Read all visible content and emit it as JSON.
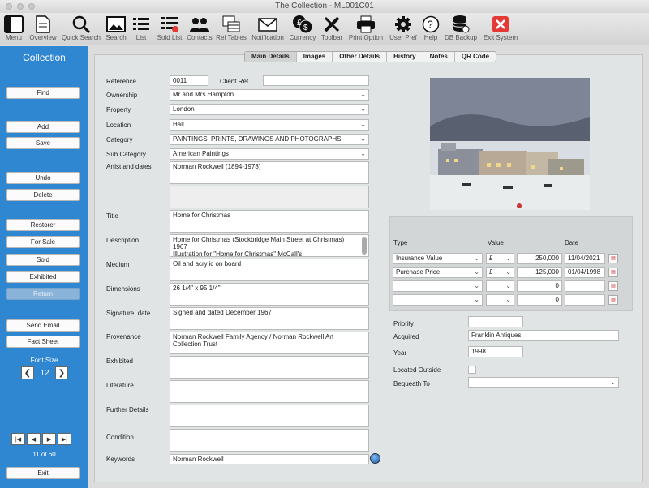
{
  "window": {
    "title": "The Collection - ML001C01"
  },
  "toolbar": [
    {
      "label": "Menu",
      "icon": "menu-icon"
    },
    {
      "label": "Overview",
      "icon": "overview-icon"
    },
    {
      "label": "Quick Search",
      "icon": "magnifier-icon"
    },
    {
      "label": "Search",
      "icon": "picture-search-icon"
    },
    {
      "label": "List",
      "icon": "list-icon"
    },
    {
      "label": "Sold List",
      "icon": "sold-list-icon"
    },
    {
      "label": "Contacts",
      "icon": "contacts-icon"
    },
    {
      "label": "Ref Tables",
      "icon": "ref-tables-icon"
    },
    {
      "label": "Notification",
      "icon": "envelope-icon"
    },
    {
      "label": "Currency",
      "icon": "currency-icon"
    },
    {
      "label": "Toolbar",
      "icon": "toolbar-tools-icon"
    },
    {
      "label": "Print Option",
      "icon": "printer-icon"
    },
    {
      "label": "User Pref",
      "icon": "gear-icon"
    },
    {
      "label": "Help",
      "icon": "help-icon"
    },
    {
      "label": "DB Backup",
      "icon": "database-icon"
    },
    {
      "label": "Exit System",
      "icon": "exit-icon"
    }
  ],
  "sidebar": {
    "title": "Collection",
    "buttons": {
      "find": "Find",
      "add": "Add",
      "save": "Save",
      "undo": "Undo",
      "delete": "Delete",
      "restorer": "Restorer",
      "for_sale": "For Sale",
      "sold": "Sold",
      "exhibited": "Exhibited",
      "return": "Return",
      "send_email": "Send Email",
      "fact_sheet": "Fact Sheet",
      "exit": "Exit"
    },
    "font_size_label": "Font Size",
    "font_size": "12",
    "record_position": "11 of 60"
  },
  "tabs": [
    "Main Details",
    "Images",
    "Other Details",
    "History",
    "Notes",
    "QR Code"
  ],
  "form": {
    "reference_label": "Reference",
    "reference": "0011",
    "client_ref_label": "Client Ref",
    "client_ref": "",
    "ownership_label": "Ownership",
    "ownership": "Mr and Mrs Hampton",
    "property_label": "Property",
    "property": "London",
    "location_label": "Location",
    "location": "Hall",
    "category_label": "Category",
    "category": "PAINTINGS, PRINTS, DRAWINGS AND PHOTOGRAPHS",
    "sub_category_label": "Sub Category",
    "sub_category": "American Paintings",
    "artist_label": "Artist and dates",
    "artist": "Norman Rockwell (1894-1978)",
    "title_label": "Title",
    "title": "Home for Christmas",
    "description_label": "Description",
    "description": "Home for Christmas (Stockbridge Main Street at Christmas)\n1967\nIllustration for \"Home for Christmas\" McCall's",
    "medium_label": "Medium",
    "medium": "Oil and acrylic on board",
    "dimensions_label": "Dimensions",
    "dimensions": "26 1/4\" x 95 1/4\"",
    "signature_label": "Signature, date",
    "signature": "Signed and dated December 1967",
    "provenance_label": "Provenance",
    "provenance": "Norman Rockwell Family Agency / Norman Rockwell Art\nCollection Trust",
    "exhibited_label": "Exhibited",
    "exhibited": "",
    "literature_label": "Literature",
    "literature": "",
    "further_label": "Further Details",
    "further": "",
    "condition_label": "Condition",
    "condition": "",
    "keywords_label": "Keywords",
    "keywords": "Norman Rockwell"
  },
  "values": {
    "type_header": "Type",
    "value_header": "Value",
    "date_header": "Date",
    "rows": [
      {
        "type": "Insurance Value",
        "currency": "£",
        "amount": "250,000",
        "date": "11/04/2021"
      },
      {
        "type": "Purchase Price",
        "currency": "£",
        "amount": "125,000",
        "date": "01/04/1998"
      },
      {
        "type": "",
        "currency": "",
        "amount": "0",
        "date": ""
      },
      {
        "type": "",
        "currency": "",
        "amount": "0",
        "date": ""
      }
    ]
  },
  "right": {
    "priority_label": "Priority",
    "priority": "",
    "acquired_label": "Acquired",
    "acquired": "Franklin Antiques",
    "year_label": "Year",
    "year": "1998",
    "located_outside_label": "Located Outside",
    "bequeath_label": "Bequeath To",
    "bequeath": ""
  },
  "colors": {
    "sidebar": "#2f86d1",
    "exit_red": "#e53935"
  }
}
